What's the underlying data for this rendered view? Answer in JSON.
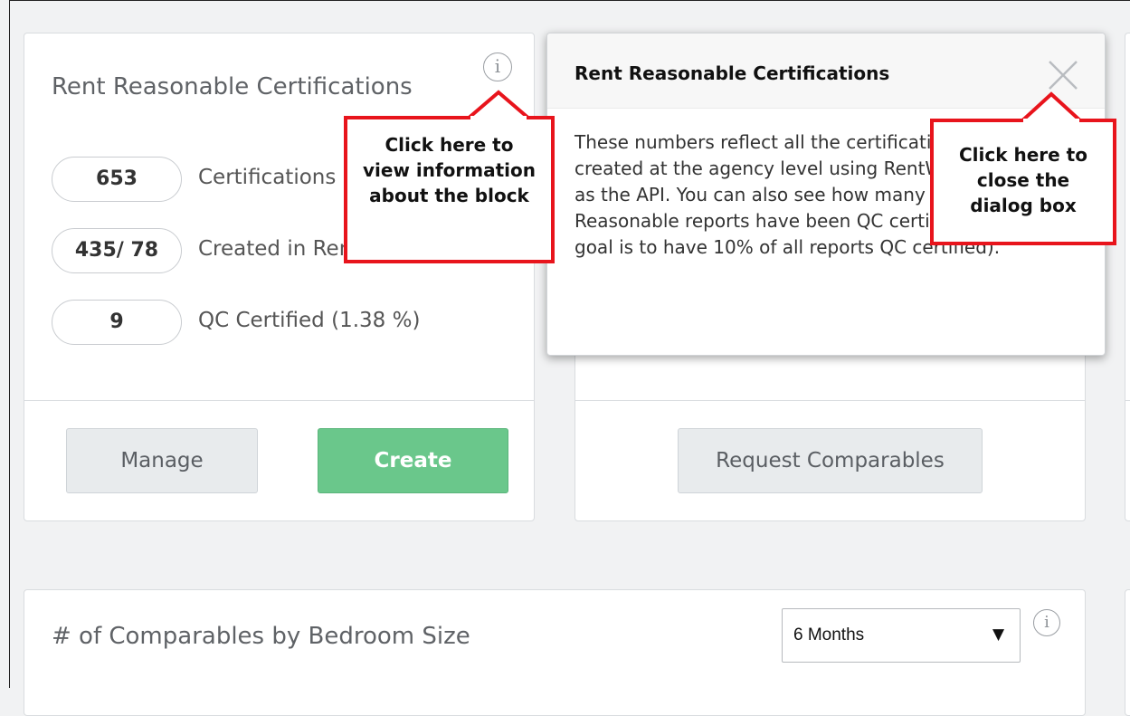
{
  "certifications_card": {
    "title": "Rent Reasonable Certifications",
    "stats": [
      {
        "value": "653",
        "label": "Certifications"
      },
      {
        "value": "435/ 78",
        "label": "Created in RentWatch5/API"
      },
      {
        "value": "9",
        "label": "QC Certified (1.38 %)"
      }
    ],
    "manage_label": "Manage",
    "create_label": "Create"
  },
  "comparables_card": {
    "request_label": "Request Comparables"
  },
  "popover": {
    "title": "Rent Reasonable Certifications",
    "body": "These numbers reflect all the certifications that were created at the agency level using RentWatch5 as well as the API. You can also see how many Rent Reasonable reports have been QC certified (a typical goal is to have 10% of all reports QC certified)."
  },
  "callouts": {
    "info": "Click here to view information about the block",
    "close": "Click here to close the dialog box"
  },
  "bedroom_card": {
    "title": "# of Comparables by Bedroom Size",
    "period_value": "6 Months"
  },
  "icons": {
    "info": "info-icon",
    "close": "close-icon",
    "dropdown": "chevron-down-icon"
  },
  "colors": {
    "callout_border": "#e8141c",
    "create_button": "#6ac78b",
    "page_background": "#f1f2f3"
  }
}
